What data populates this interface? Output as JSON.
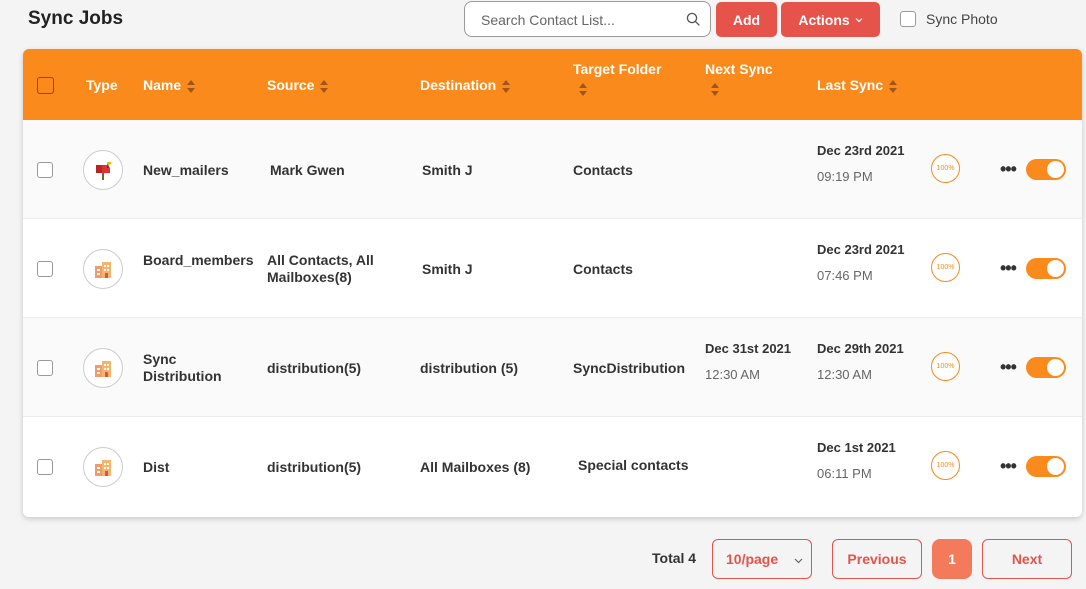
{
  "header": {
    "title": "Sync Jobs",
    "search_placeholder": "Search Contact List...",
    "add_label": "Add",
    "actions_label": "Actions",
    "sync_photo_label": "Sync Photo"
  },
  "table": {
    "columns": {
      "type": "Type",
      "name": "Name",
      "source": "Source",
      "destination": "Destination",
      "target_folder": "Target Folder",
      "next_sync": "Next Sync",
      "last_sync": "Last Sync"
    },
    "rows": [
      {
        "icon": "mailbox-icon",
        "name": "New_mailers",
        "source": "Mark Gwen",
        "destination": "Smith J",
        "target_folder": "Contacts",
        "next_sync_date": "",
        "next_sync_time": "",
        "last_sync_date": "Dec 23rd 2021",
        "last_sync_time": "09:19 PM",
        "progress": "100%",
        "enabled": true
      },
      {
        "icon": "building-icon",
        "name": "Board_members",
        "source": "All Contacts, All Mailboxes(8)",
        "destination": "Smith J",
        "target_folder": "Contacts",
        "next_sync_date": "",
        "next_sync_time": "",
        "last_sync_date": "Dec 23rd 2021",
        "last_sync_time": "07:46 PM",
        "progress": "100%",
        "enabled": true
      },
      {
        "icon": "building-icon",
        "name": "Sync Distribution",
        "source": "distribution(5)",
        "destination": "distribution (5)",
        "target_folder": "SyncDistribution",
        "next_sync_date": "Dec 31st 2021",
        "next_sync_time": "12:30 AM",
        "last_sync_date": "Dec 29th 2021",
        "last_sync_time": "12:30 AM",
        "progress": "100%",
        "enabled": true
      },
      {
        "icon": "building-icon",
        "name": "Dist",
        "source": "distribution(5)",
        "destination": "All Mailboxes (8)",
        "target_folder": "Special contacts",
        "next_sync_date": "",
        "next_sync_time": "",
        "last_sync_date": "Dec 1st 2021",
        "last_sync_time": "06:11 PM",
        "progress": "100%",
        "enabled": true
      }
    ]
  },
  "pagination": {
    "total_label": "Total 4",
    "page_size": "10/page",
    "previous_label": "Previous",
    "current_page": "1",
    "next_label": "Next"
  },
  "colors": {
    "accent": "#fb8a1c",
    "button": "#e5534b"
  }
}
